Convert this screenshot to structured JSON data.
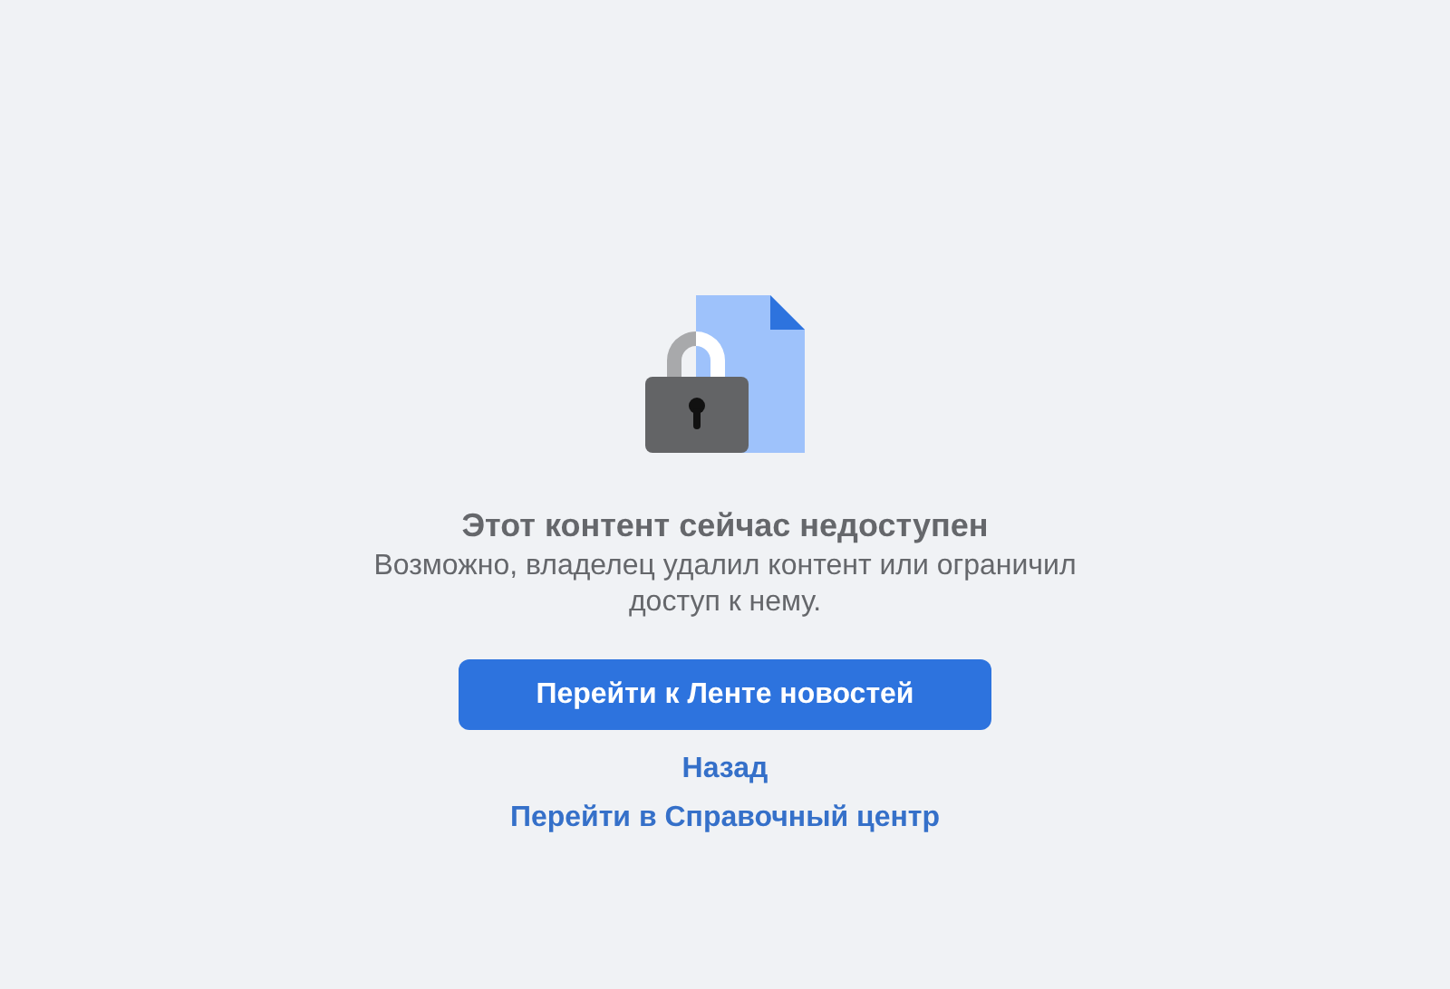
{
  "title": "Этот контент сейчас недоступен",
  "message": "Возможно, владелец удалил контент или ограничил доступ к нему.",
  "primary_button": "Перейти к Ленте новостей",
  "links": [
    "Назад",
    "Перейти в Справочный центр"
  ]
}
